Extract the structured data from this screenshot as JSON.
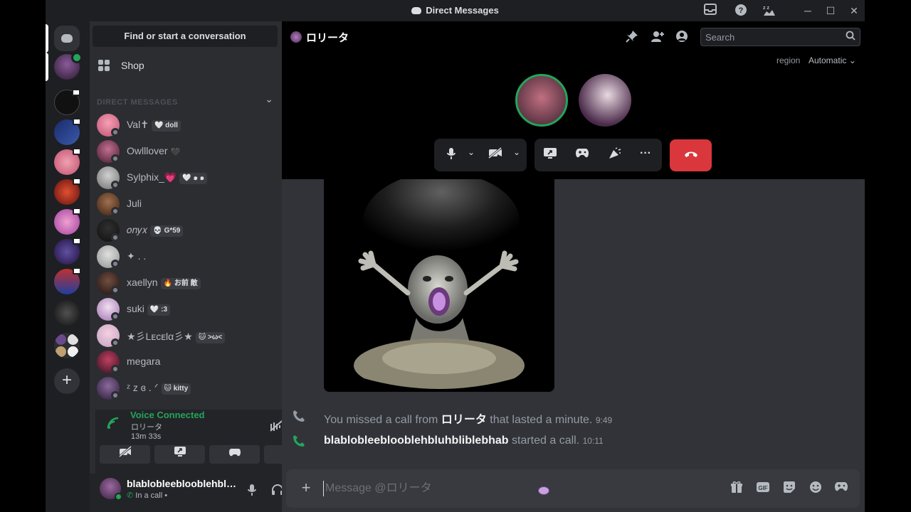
{
  "window": {
    "title": "Direct Messages"
  },
  "dm": {
    "find_label": "Find or start a conversation",
    "shop_label": "Shop",
    "section_header": "DIRECT MESSAGES",
    "items": [
      {
        "name": "Val✝",
        "tag": "🤍 doll"
      },
      {
        "name": "Owlllover",
        "tag": "🖤"
      },
      {
        "name": "Sylphix_💗",
        "tag": "🤍 ๑ ๑"
      },
      {
        "name": "Juli",
        "tag": ""
      },
      {
        "name": "𝑜𝑛𝑦𝑥",
        "tag": "💀 G*59"
      },
      {
        "name": "✦ . .",
        "tag": ""
      },
      {
        "name": "xaellyn",
        "tag": "🔥 お前 敵"
      },
      {
        "name": "suki",
        "tag": "🤍 :3"
      },
      {
        "name": "★彡Lᴇᴄᴇlα彡★",
        "tag": "🐱 >ω<"
      },
      {
        "name": "megara",
        "tag": ""
      },
      {
        "name": "ᶻ z ɞ . ᐟ",
        "tag": "🐱 kitty"
      }
    ]
  },
  "voice": {
    "title": "Voice Connected",
    "channel": "ロリータ",
    "elapsed": "13m 33s"
  },
  "user": {
    "name": "blabloblееblооblehbluhbliblebhab",
    "status": "In a call •"
  },
  "channel": {
    "name": "ロリータ",
    "search_placeholder": "Search",
    "region_label": "region",
    "region_value": "Automatic ⌄"
  },
  "messages": [
    {
      "type": "missed",
      "prefix": "You missed a call from ",
      "bold": "ロリータ",
      "suffix": " that lasted a minute. ",
      "time": "9:49"
    },
    {
      "type": "started",
      "prefix": "",
      "bold": "blabloblееblооblehbluhbliblebhab",
      "suffix": " started a call. ",
      "time": "10:11"
    }
  ],
  "composer": {
    "placeholder": "Message @ロリータ",
    "gif_label": "GIF"
  },
  "colors": {
    "accent_green": "#23a55a",
    "hangup_red": "#da373c",
    "bg_main": "#313338",
    "bg_sidebar": "#2b2d31"
  }
}
